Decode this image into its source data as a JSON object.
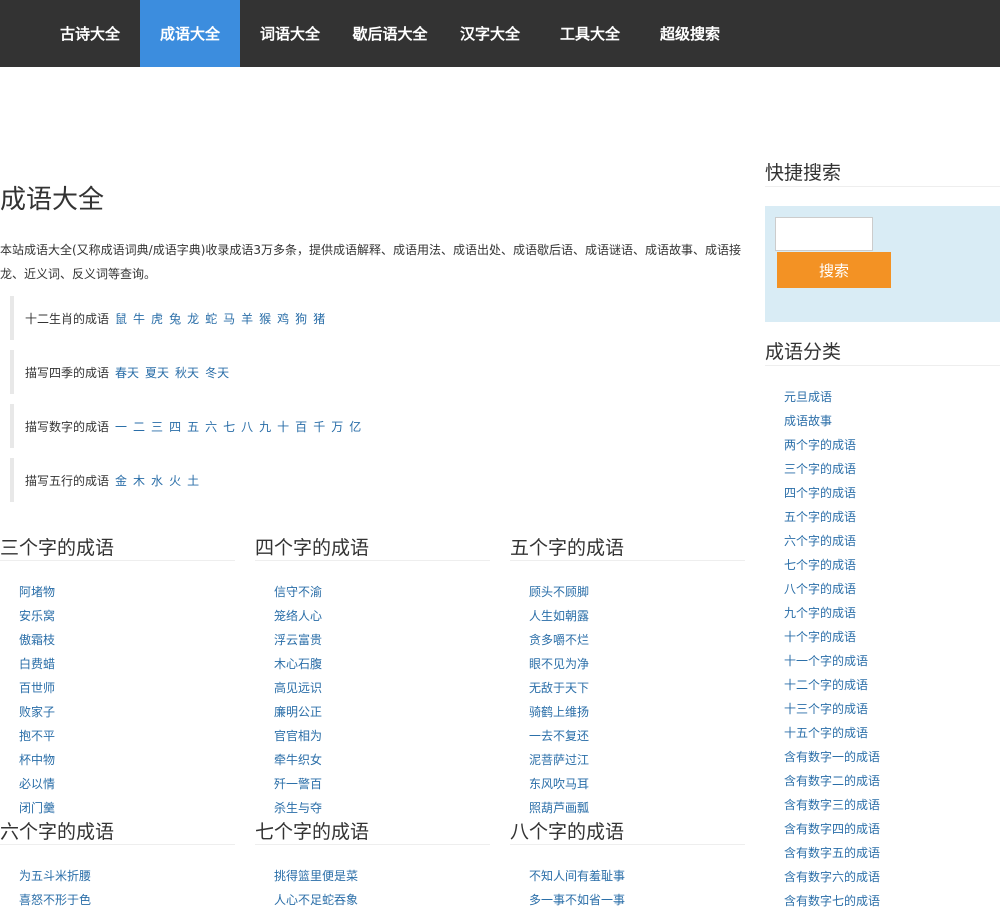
{
  "nav": {
    "items": [
      {
        "label": "古诗大全"
      },
      {
        "label": "成语大全"
      },
      {
        "label": "词语大全"
      },
      {
        "label": "歇后语大全"
      },
      {
        "label": "汉字大全"
      },
      {
        "label": "工具大全"
      },
      {
        "label": "超级搜索"
      }
    ],
    "active": "成语大全"
  },
  "main": {
    "title": "成语大全",
    "intro": "本站成语大全(又称成语词典/成语字典)收录成语3万多条，提供成语解释、成语用法、成语出处、成语歇后语、成语谜语、成语故事、成语接龙、近义词、反义词等查询。",
    "categories": [
      {
        "label": "十二生肖的成语",
        "links": [
          "鼠",
          "牛",
          "虎",
          "兔",
          "龙",
          "蛇",
          "马",
          "羊",
          "猴",
          "鸡",
          "狗",
          "猪"
        ]
      },
      {
        "label": "描写四季的成语",
        "links": [
          "春天",
          "夏天",
          "秋天",
          "冬天"
        ]
      },
      {
        "label": "描写数字的成语",
        "links": [
          "一",
          "二",
          "三",
          "四",
          "五",
          "六",
          "七",
          "八",
          "九",
          "十",
          "百",
          "千",
          "万",
          "亿"
        ]
      },
      {
        "label": "描写五行的成语",
        "links": [
          "金",
          "木",
          "水",
          "火",
          "土"
        ]
      }
    ],
    "columns": [
      {
        "title": "三个字的成语",
        "items": [
          "阿堵物",
          "安乐窝",
          "傲霜枝",
          "白费蜡",
          "百世师",
          "败家子",
          "抱不平",
          "杯中物",
          "必以情",
          "闭门羹"
        ]
      },
      {
        "title": "四个字的成语",
        "items": [
          "信守不渝",
          "笼络人心",
          "浮云富贵",
          "木心石腹",
          "高见远识",
          "廉明公正",
          "官官相为",
          "牵牛织女",
          "歼一警百",
          "杀生与夺"
        ]
      },
      {
        "title": "五个字的成语",
        "items": [
          "顾头不顾脚",
          "人生如朝露",
          "贪多嚼不烂",
          "眼不见为净",
          "无敌于天下",
          "骑鹤上维扬",
          "一去不复还",
          "泥菩萨过江",
          "东风吹马耳",
          "照葫芦画瓢"
        ]
      },
      {
        "title": "六个字的成语",
        "items": [
          "为五斗米折腰",
          "喜怒不形于色"
        ]
      },
      {
        "title": "七个字的成语",
        "items": [
          "挑得篮里便是菜",
          "人心不足蛇吞象"
        ]
      },
      {
        "title": "八个字的成语",
        "items": [
          "不知人间有羞耻事",
          "多一事不如省一事"
        ]
      }
    ]
  },
  "sidebar": {
    "search_title": "快捷搜索",
    "search_placeholder": "",
    "search_button": "搜索",
    "category_title": "成语分类",
    "categories": [
      "元旦成语",
      "成语故事",
      "两个字的成语",
      "三个字的成语",
      "四个字的成语",
      "五个字的成语",
      "六个字的成语",
      "七个字的成语",
      "八个字的成语",
      "九个字的成语",
      "十个字的成语",
      "十一个字的成语",
      "十二个字的成语",
      "十三个字的成语",
      "十五个字的成语",
      "含有数字一的成语",
      "含有数字二的成语",
      "含有数字三的成语",
      "含有数字四的成语",
      "含有数字五的成语",
      "含有数字六的成语",
      "含有数字七的成语"
    ]
  },
  "colors": {
    "nav_bg": "#333333",
    "nav_active": "#3c8dde",
    "link": "#2a6ea8",
    "search_panel": "#d9ecf5",
    "search_button": "#f39224"
  }
}
